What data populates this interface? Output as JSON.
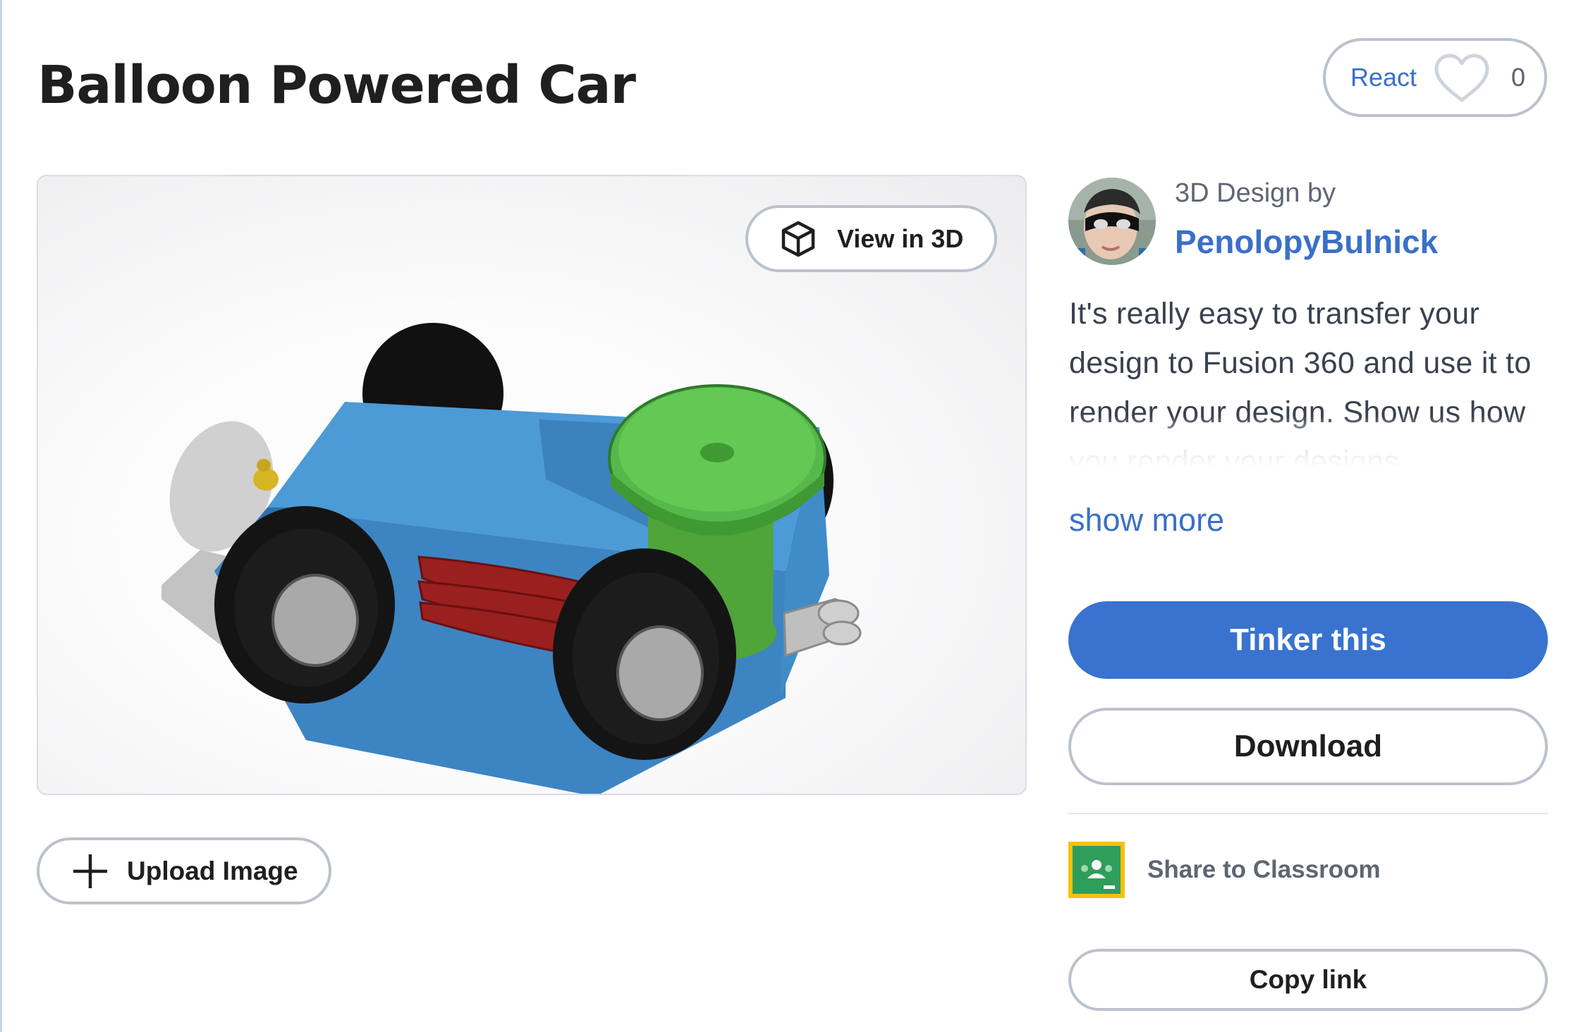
{
  "design": {
    "title": "Balloon Powered Car"
  },
  "react": {
    "label": "React",
    "count": "0"
  },
  "viewer": {
    "view_3d_label": "View in 3D",
    "upload_label": "Upload Image"
  },
  "author": {
    "byline_prefix": "3D Design by",
    "name": "PenolopyBulnick"
  },
  "description": {
    "text": "It's really easy to transfer your design to Fusion 360 and use it to render your design. Show us how you render your designs",
    "show_more_label": "show more"
  },
  "actions": {
    "tinker_label": "Tinker this",
    "download_label": "Download",
    "share_classroom_label": "Share to Classroom",
    "copy_link_label": "Copy link"
  },
  "icons": {
    "react": "heart-icon",
    "view_3d": "cube-icon",
    "upload": "plus-icon",
    "share": "google-classroom-icon"
  },
  "colors": {
    "accent": "#3973cf",
    "link": "#3a70c9",
    "border": "#bcc2cc",
    "title": "#1f1f1f",
    "body_text": "#3a4150"
  }
}
